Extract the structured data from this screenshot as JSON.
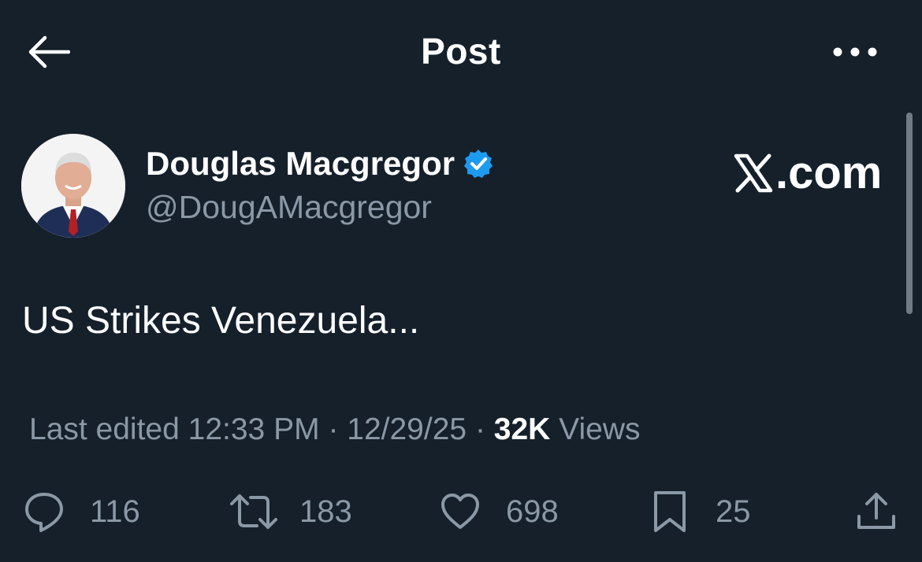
{
  "header": {
    "title": "Post",
    "back_icon": "arrow-left-icon",
    "more_icon": "more-horizontal-icon"
  },
  "author": {
    "name": "Douglas Macgregor",
    "handle": "@DougAMacgregor",
    "verified": true,
    "verified_color": "#1d9bf0"
  },
  "watermark": {
    "logo": "x-logo",
    "suffix": ".com"
  },
  "post": {
    "text": "US Strikes Venezuela..."
  },
  "meta": {
    "edited_label": "Last edited",
    "time": "12:33 PM",
    "date": "12/29/25",
    "separator": "·",
    "views_count": "32K",
    "views_label": "Views"
  },
  "actions": {
    "replies": "116",
    "reposts": "183",
    "likes": "698",
    "bookmarks": "25"
  },
  "colors": {
    "background": "#15202b",
    "text": "#ffffff",
    "secondary": "#8b98a5"
  }
}
